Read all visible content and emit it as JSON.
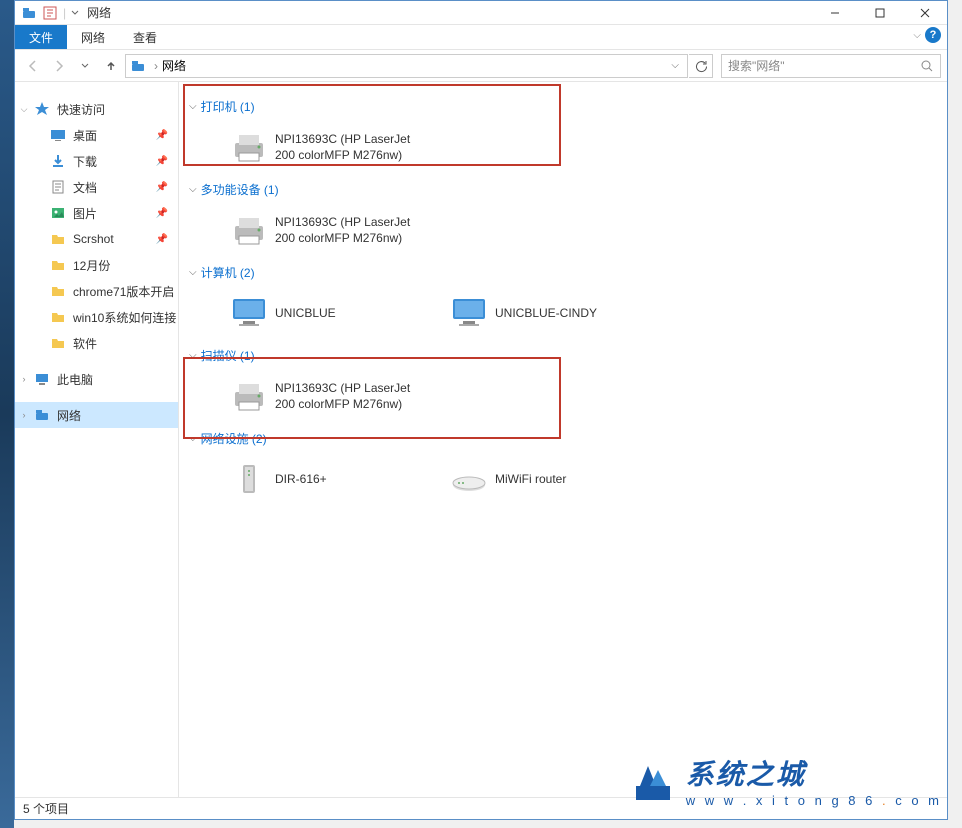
{
  "title": "网络",
  "menubar": {
    "file": "文件",
    "network": "网络",
    "view": "查看"
  },
  "address": {
    "root": "网络",
    "search_placeholder": "搜索\"网络\""
  },
  "nav": {
    "quick_access": "快速访问",
    "items": [
      {
        "label": "桌面",
        "pinned": true
      },
      {
        "label": "下载",
        "pinned": true
      },
      {
        "label": "文档",
        "pinned": true
      },
      {
        "label": "图片",
        "pinned": true
      },
      {
        "label": "Scrshot",
        "pinned": true
      },
      {
        "label": "12月份",
        "pinned": false
      },
      {
        "label": "chrome71版本开启",
        "pinned": false
      },
      {
        "label": "win10系统如何连接",
        "pinned": false
      },
      {
        "label": "软件",
        "pinned": false
      }
    ],
    "this_pc": "此电脑",
    "network": "网络"
  },
  "groups": {
    "printers": {
      "title": "打印机 (1)",
      "items": [
        {
          "line1": "NPI13693C (HP LaserJet",
          "line2": "200 colorMFP M276nw)"
        }
      ]
    },
    "multifunction": {
      "title": "多功能设备 (1)",
      "items": [
        {
          "line1": "NPI13693C (HP LaserJet",
          "line2": "200 colorMFP M276nw)"
        }
      ]
    },
    "computers": {
      "title": "计算机 (2)",
      "items": [
        {
          "line1": "UNICBLUE",
          "line2": ""
        },
        {
          "line1": "UNICBLUE-CINDY",
          "line2": ""
        }
      ]
    },
    "scanners": {
      "title": "扫描仪 (1)",
      "items": [
        {
          "line1": "NPI13693C (HP LaserJet",
          "line2": "200 colorMFP M276nw)"
        }
      ]
    },
    "infrastructure": {
      "title": "网络设施 (2)",
      "items": [
        {
          "line1": "DIR-616+",
          "line2": ""
        },
        {
          "line1": "MiWiFi router",
          "line2": ""
        }
      ]
    }
  },
  "status": {
    "count": "5 个项目"
  },
  "watermark": {
    "brand": "系统之城",
    "url_pre": "w w w . x i t o n g 8 6",
    "url_dot": " . ",
    "url_post": "c o m"
  }
}
